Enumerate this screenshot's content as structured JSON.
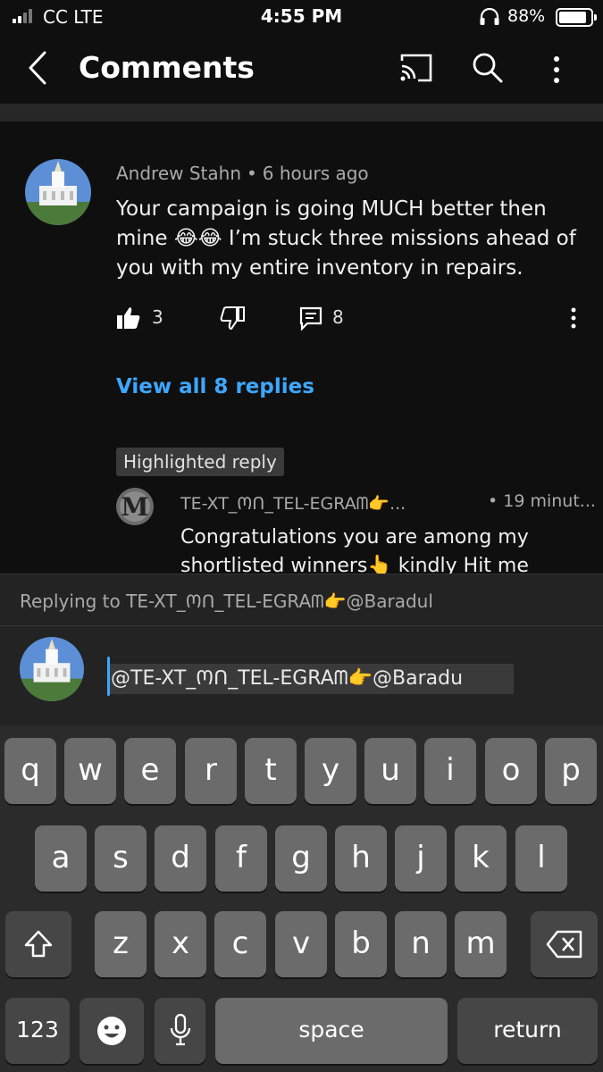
{
  "status_bar": {
    "carrier": "CC   LTE",
    "time": "4:55 PM",
    "battery_percent": "88%",
    "battery_level": 0.88
  },
  "app_bar": {
    "title": "Comments"
  },
  "comment": {
    "author": "Andrew Stahn",
    "age": "6 hours ago",
    "text": "Your campaign is going MUCH better then mine 😂😂 I’m stuck three missions ahead of you with my entire inventory in repairs.",
    "like_count": "3",
    "reply_count": "8",
    "view_replies_label": "View all 8 replies"
  },
  "highlighted": {
    "badge": "Highlighted reply",
    "author": "TE-XT_Ოᑎ_TEL-EGRAᗰ👉...",
    "age": "19 minut...",
    "text": "Congratulations you are among my shortlisted winners👆 kindly Hit me",
    "avatar_letter": "M"
  },
  "reply_box": {
    "replying_to": "Replying to TE-XT_Ოᑎ_TEL-EGRAᗰ👉@Baradul",
    "input_value": "@TE-XT_Ოᑎ_TEL-EGRAᗰ👉@Baradu"
  },
  "keyboard": {
    "row1": [
      "q",
      "w",
      "e",
      "r",
      "t",
      "y",
      "u",
      "i",
      "o",
      "p"
    ],
    "row2": [
      "a",
      "s",
      "d",
      "f",
      "g",
      "h",
      "j",
      "k",
      "l"
    ],
    "row3": [
      "z",
      "x",
      "c",
      "v",
      "b",
      "n",
      "m"
    ],
    "numbers_label": "123",
    "space_label": "space",
    "return_label": "return"
  }
}
